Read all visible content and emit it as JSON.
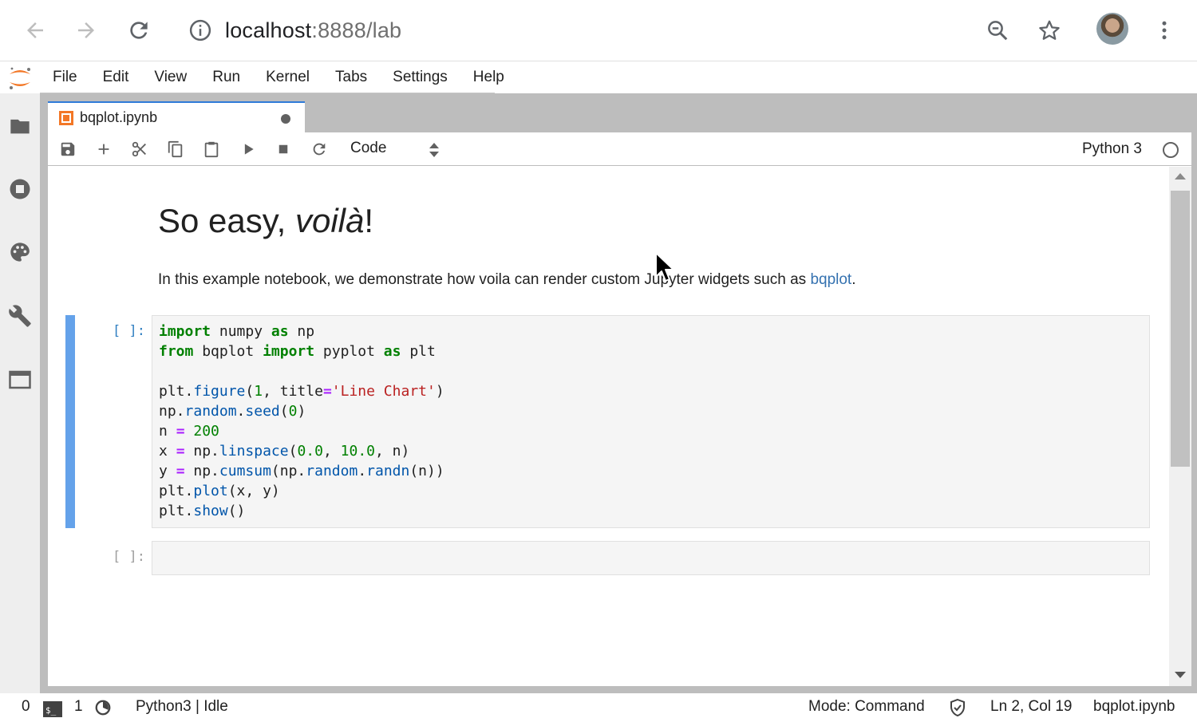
{
  "browser": {
    "url_host": "localhost",
    "url_path": ":8888/lab"
  },
  "menu": {
    "items": [
      "File",
      "Edit",
      "View",
      "Run",
      "Kernel",
      "Tabs",
      "Settings",
      "Help"
    ]
  },
  "sidebar": {
    "icons": [
      "folder-icon",
      "running-icon",
      "palette-icon",
      "wrench-icon",
      "tabs-icon"
    ]
  },
  "tab": {
    "title": "bqplot.ipynb"
  },
  "toolbar": {
    "cell_type": "Code",
    "kernel_name": "Python 3"
  },
  "notebook": {
    "heading_prefix": "So easy, ",
    "heading_italic": "voilà",
    "heading_suffix": "!",
    "paragraph_text": "In this example notebook, we demonstrate how voila can render custom Jupyter widgets such as ",
    "paragraph_link": "bqplot",
    "paragraph_end": ".",
    "code_prompt": "[ ]:",
    "empty_prompt": "[ ]:"
  },
  "statusbar": {
    "terminals_count": "0",
    "kernels_count": "1",
    "kernel_status": "Python3 | Idle",
    "mode": "Mode: Command",
    "cursor_position": "Ln 2, Col 19",
    "filename": "bqplot.ipynb"
  },
  "colors": {
    "accent": "#2f7bd9",
    "active_cell": "#64a2ea",
    "jupyter_orange": "#f37726",
    "link": "#3572b0"
  }
}
